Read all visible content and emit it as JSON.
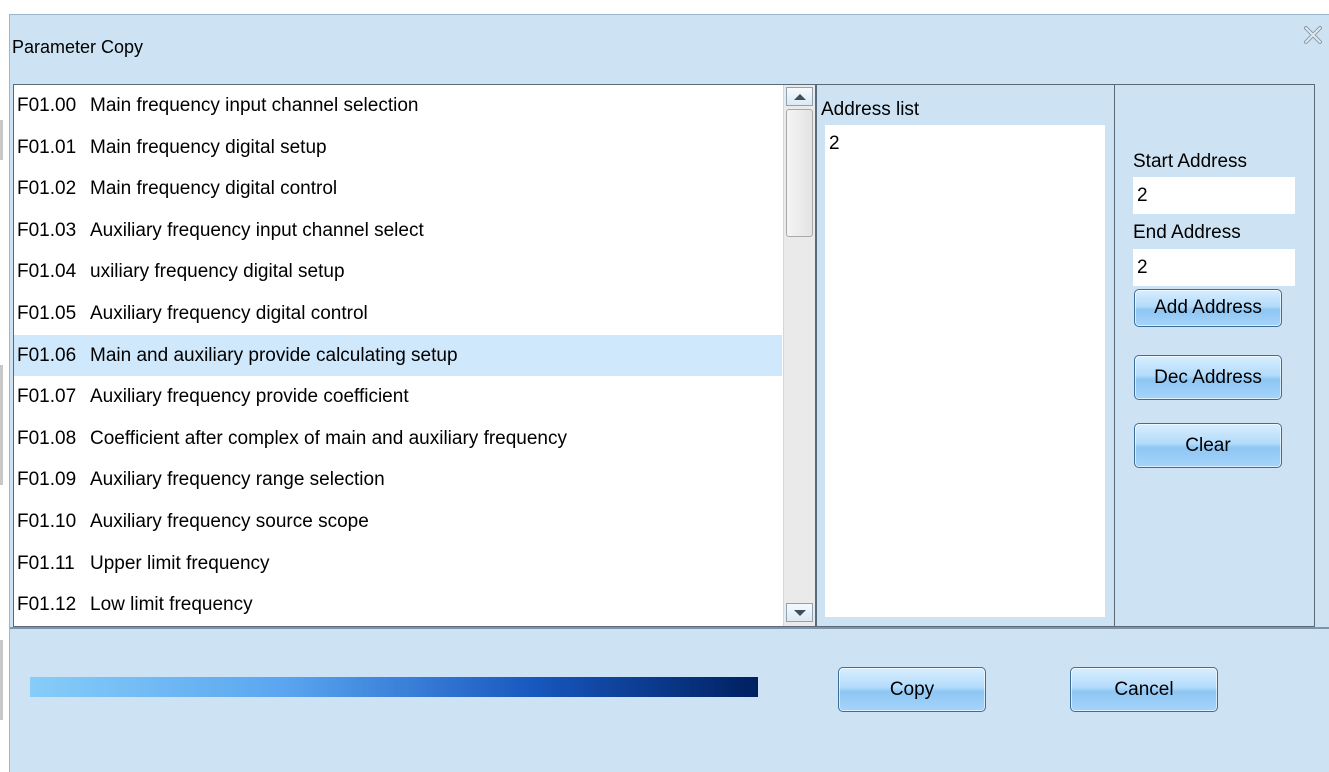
{
  "dialog": {
    "title": "Parameter Copy"
  },
  "parameters": [
    {
      "code": "F01.00",
      "name": "Main frequency input channel selection",
      "selected": false
    },
    {
      "code": "F01.01",
      "name": "Main frequency digital setup",
      "selected": false
    },
    {
      "code": "F01.02",
      "name": "Main frequency digital control",
      "selected": false
    },
    {
      "code": "F01.03",
      "name": "Auxiliary frequency input channel select",
      "selected": false
    },
    {
      "code": "F01.04",
      "name": "uxiliary frequency digital setup",
      "selected": false
    },
    {
      "code": "F01.05",
      "name": "Auxiliary frequency digital control",
      "selected": false
    },
    {
      "code": "F01.06",
      "name": "Main and auxiliary provide calculating setup",
      "selected": true
    },
    {
      "code": "F01.07",
      "name": "Auxiliary frequency provide coefficient",
      "selected": false
    },
    {
      "code": "F01.08",
      "name": "Coefficient after complex of main and auxiliary frequency",
      "selected": false
    },
    {
      "code": "F01.09",
      "name": "Auxiliary frequency range selection",
      "selected": false
    },
    {
      "code": "F01.10",
      "name": "Auxiliary frequency source scope",
      "selected": false
    },
    {
      "code": "F01.11",
      "name": "Upper limit frequency",
      "selected": false
    },
    {
      "code": "F01.12",
      "name": "Low limit frequency",
      "selected": false
    }
  ],
  "address_list": {
    "label": "Address list",
    "items": [
      "2"
    ]
  },
  "controls": {
    "start_label": "Start Address",
    "start_value": "2",
    "end_label": "End Address",
    "end_value": "2",
    "add_label": "Add Address",
    "dec_label": "Dec Address",
    "clear_label": "Clear"
  },
  "footer": {
    "progress_fraction": 1.0,
    "copy_label": "Copy",
    "cancel_label": "Cancel"
  },
  "icons": {
    "close": "close-icon",
    "scroll_up": "scroll-up-arrow-icon",
    "scroll_down": "scroll-down-arrow-icon"
  }
}
